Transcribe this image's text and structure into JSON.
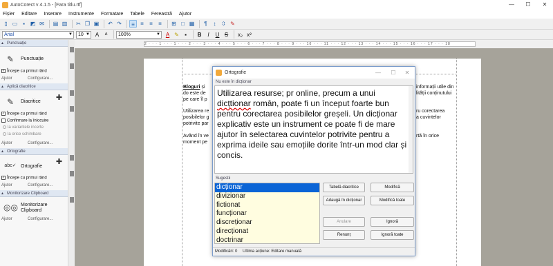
{
  "window": {
    "title": "AutoCorect v 4.1.5 - [Fara titlu.rtf]",
    "controls": [
      "—",
      "☐",
      "✕"
    ]
  },
  "menu": [
    "Fișier",
    "Editare",
    "Inserare",
    "Instrumente",
    "Formatare",
    "Tabele",
    "Fereastră",
    "Ajutor"
  ],
  "format_bar": {
    "font": "Arial",
    "size": "10",
    "zoom": "100%",
    "buttons": [
      "B",
      "I",
      "U",
      "S",
      "x₂",
      "x²"
    ]
  },
  "ruler_text": "2 · · · 1 · · · 1 · · · 2 · · · 3 · · · 4 · · · 5 · · · 6 · · · 7 · · · 8 · · · 9 · · · 10 · · · 11 · · · 12 · · · 13 · · · 14 · · · 15 · · · 16 · · · 17 · · · 18",
  "sidebar": {
    "punctuation": {
      "header": "Punctuație",
      "title": "Punctuație",
      "check": "Începe cu primul rând",
      "help": "Ajutor",
      "config": "Configurare..."
    },
    "diacritics": {
      "header": "Aplică diacritice",
      "title": "Diacritice",
      "check1": "Începe cu primul rând",
      "check2": "Confirmare la înlocuire",
      "radio1": "la variantele incerte",
      "radio2": "la orice schimbare",
      "help": "Ajutor",
      "config": "Configurare..."
    },
    "spelling": {
      "header": "Ortografie",
      "title": "Ortografie",
      "check": "Începe cu primul rând",
      "help": "Ajutor",
      "config": "Configurare..."
    },
    "clipboard": {
      "header": "Monitorizare Clipboard",
      "title": "Monitorizare Clipboard",
      "help": "Ajutor",
      "config": "Configurare..."
    }
  },
  "document": {
    "p1a": "Bloguri",
    "p1a_suffix": " și",
    "p1b": "do este de",
    "p1c": "pe care îl p",
    "p2a": "Utilizarea re",
    "p2b": "posibilelor g",
    "p2c": "potrivite par",
    "p3a": "Având în ve",
    "p3b": "moment pe",
    "r1a": "informații utile din",
    "r1b": "lității conținutului",
    "r2a": "ru corectarea",
    "r2b": "a cuvintelor",
    "r3a": "rtă în orice"
  },
  "dialog": {
    "title": "Ortografie",
    "not_in_dict_label": "Nu este în dicționar",
    "text_before": "Utilizarea resurse; pr online, precum a unui ",
    "text_error": "dicțtionar",
    "text_after": " român, poate fi un început foarte bun pentru corectarea posibilelor greșeli. Un dicționar explicativ este un instrument ce poate fi de mare ajutor în selectarea cuvintelor potrivite pentru a exprima ideile sau emoțiile dorite într-un mod clar și concis.",
    "suggestions_label": "Sugestii",
    "suggestions": [
      "dicționar",
      "divizionar",
      "fictionat",
      "funcționar",
      "discreționar",
      "direcționat",
      "doctrinar"
    ],
    "buttons": {
      "diacritics_table": "Tabelă diacritice",
      "add_to_dict": "Adaugă în dicționar",
      "undo": "Anulare",
      "give_up": "Renunț",
      "change": "Modifică",
      "change_all": "Modifică toate",
      "ignore": "Ignoră",
      "ignore_all": "Ignoră toate"
    },
    "status_changes": "Modificări: 0",
    "status_last": "Ultima acțiune: Editare manuală"
  }
}
